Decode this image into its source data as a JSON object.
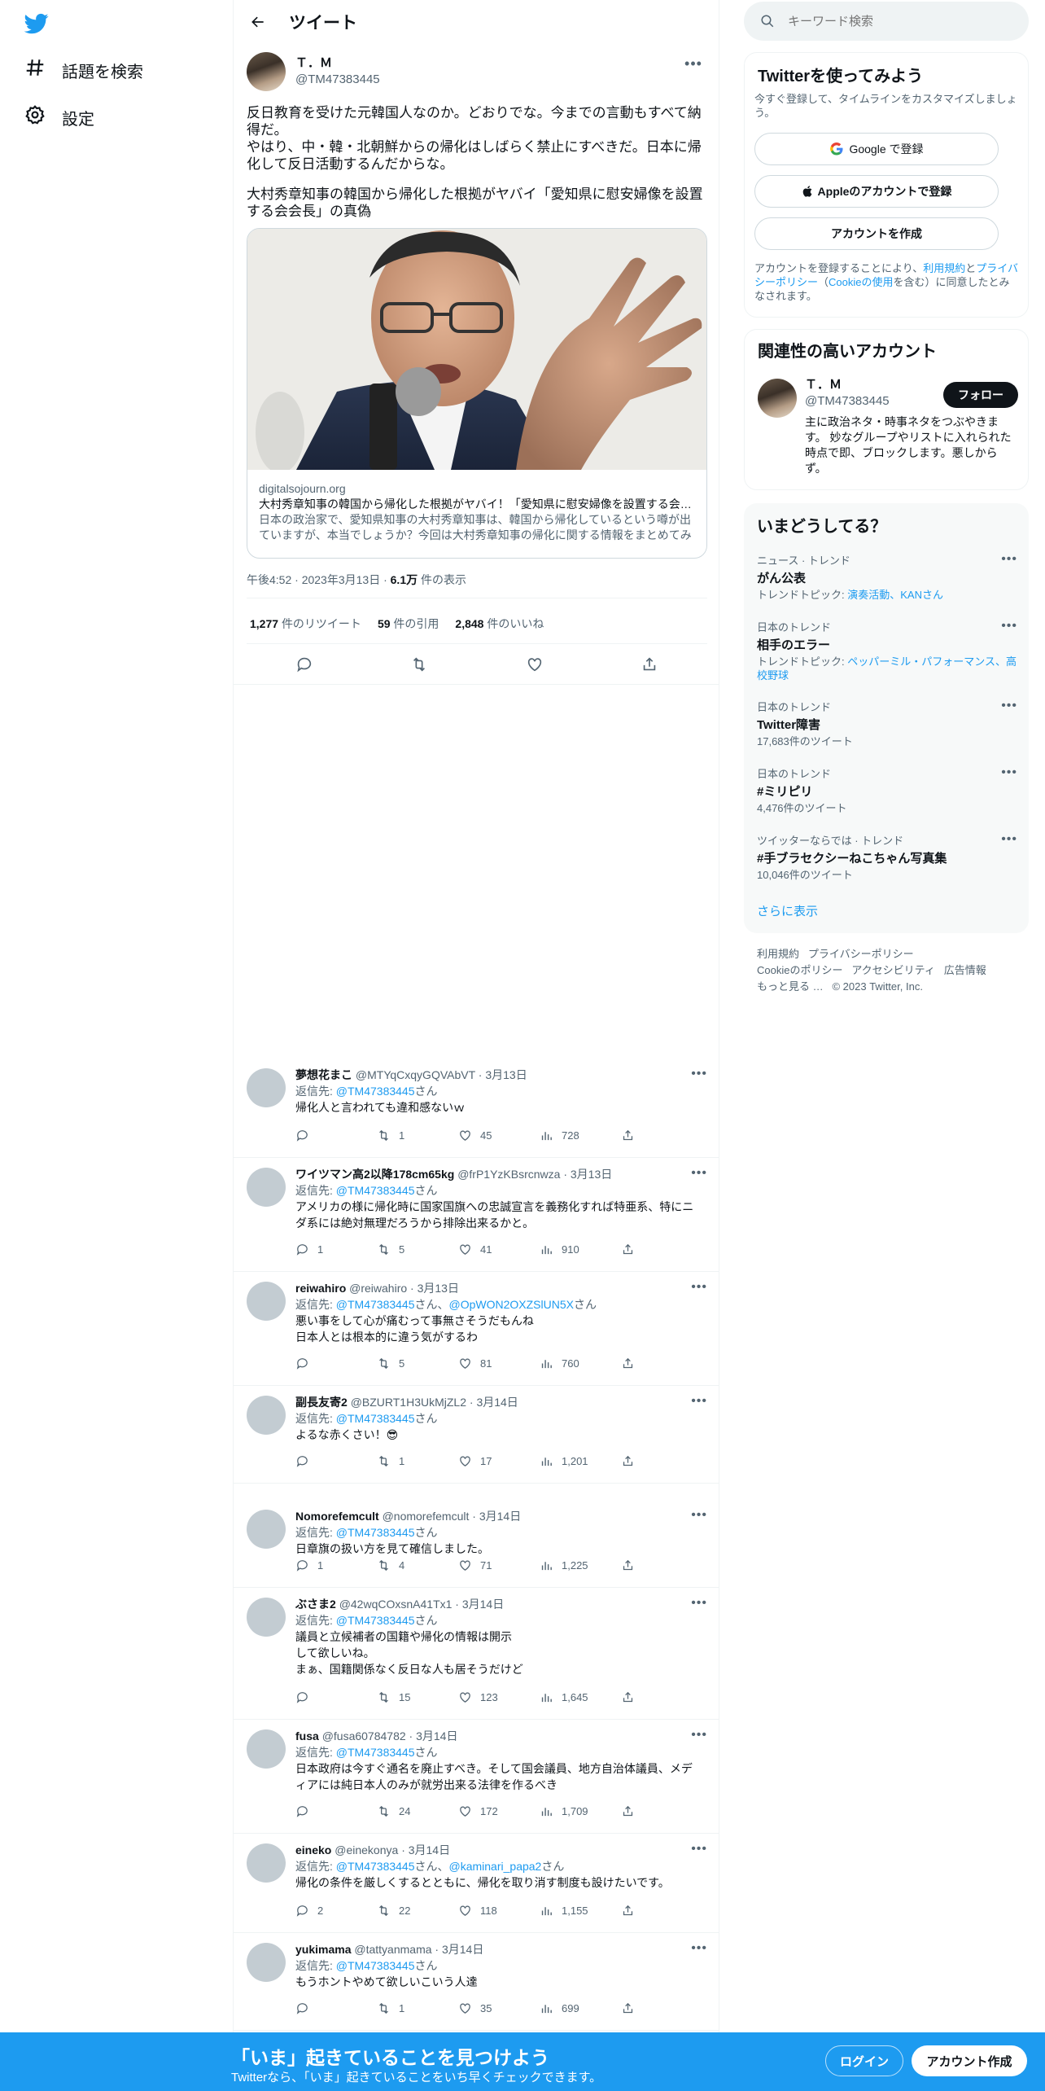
{
  "nav": {
    "explore": "話題を検索",
    "settings": "設定"
  },
  "header": {
    "title": "ツイート"
  },
  "tweet": {
    "author_name": "Ｔ．Ｍ",
    "author_handle": "@TM47383445",
    "text": "反日教育を受けた元韓国人なのか。どおりでな。今までの言動もすべて納得だ。\nやはり、中・韓・北朝鮮からの帰化はしばらく禁止にすべきだ。日本に帰化して反日活動するんだからな。",
    "text2": "大村秀章知事の韓国から帰化した根拠がヤバイ「愛知県に慰安婦像を設置する会会長」の真偽",
    "card": {
      "domain": "digitalsojourn.org",
      "title": "大村秀章知事の韓国から帰化した根拠がヤバイ！「愛知県に慰安婦像を設置する会会長」の真偽",
      "description": "日本の政治家で、愛知県知事の大村秀章知事は、韓国から帰化しているという噂が出ていますが、本当でしょうか？今回は大村秀章知事の帰化に関する情報をまとめてみました。"
    },
    "time": "午後4:52 · 2023年3月13日 · ",
    "views": "6.1万",
    "views_label": " 件の表示",
    "retweets": "1,277",
    "retweets_label": "件のリツイート",
    "quotes": "59",
    "quotes_label": "件の引用",
    "likes": "2,848",
    "likes_label": "件のいいね"
  },
  "replies": [
    {
      "name": "夢想花まこ",
      "handle": "@MTYqCxqyGQVAbVT",
      "date": "· 3月13日",
      "to_label": "返信先: ",
      "to": "@TM47383445",
      "to_suffix": "さん",
      "text": "帰化人と言われても違和感ないｗ",
      "replies": "",
      "retweets": "1",
      "likes": "45",
      "views": "728"
    },
    {
      "name": "ワイツマン高2以降178cm65kg",
      "handle": "@frP1YzKBsrcnwza",
      "date": "· 3月13日",
      "to_label": "返信先: ",
      "to": "@TM47383445",
      "to_suffix": "さん",
      "text": "アメリカの様に帰化時に国家国旗への忠誠宣言を義務化すれば特亜系、特にニダ系には絶対無理だろうから排除出来るかと。",
      "replies": "1",
      "retweets": "5",
      "likes": "41",
      "views": "910"
    },
    {
      "name": "reiwahiro",
      "handle": "@reiwahiro",
      "date": "· 3月13日",
      "to_label": "返信先: ",
      "to": "@TM47383445",
      "to_suffix": "さん、",
      "to2": "@OpWON2OXZSlUN5X",
      "to2_suffix": "さん",
      "text": "悪い事をして心が痛むって事無さそうだもんね\n日本人とは根本的に違う気がするわ",
      "replies": "",
      "retweets": "5",
      "likes": "81",
      "views": "760"
    },
    {
      "name": "副長友寄2",
      "handle": "@BZURT1H3UkMjZL2",
      "date": "· 3月14日",
      "to_label": "返信先: ",
      "to": "@TM47383445",
      "to_suffix": "さん",
      "text": "よるな赤くさい！😎",
      "replies": "",
      "retweets": "1",
      "likes": "17",
      "views": "1,201"
    },
    {
      "name": "Nomorefemcult",
      "handle": "@nomorefemcult",
      "date": "· 3月14日",
      "to_label": "返信先: ",
      "to": "@TM47383445",
      "to_suffix": "さん",
      "text": "日章旗の扱い方を見て確信しました。",
      "replies": "1",
      "retweets": "4",
      "likes": "71",
      "views": "1,225"
    },
    {
      "name": "ぶさま2",
      "handle": "@42wqCOxsnA41Tx1",
      "date": "· 3月14日",
      "to_label": "返信先: ",
      "to": "@TM47383445",
      "to_suffix": "さん",
      "text": "議員と立候補者の国籍や帰化の情報は開示\nして欲しいね。\nまぁ、国籍関係なく反日な人も居そうだけど",
      "replies": "",
      "retweets": "15",
      "likes": "123",
      "views": "1,645"
    },
    {
      "name": "fusa",
      "handle": "@fusa60784782",
      "date": "· 3月14日",
      "to_label": "返信先: ",
      "to": "@TM47383445",
      "to_suffix": "さん",
      "text": "日本政府は今すぐ通名を廃止すべき。そして国会議員、地方自治体議員、メディアには純日本人のみが就労出来る法律を作るべき",
      "replies": "",
      "retweets": "24",
      "likes": "172",
      "views": "1,709"
    },
    {
      "name": "eineko",
      "handle": "@einekonya",
      "date": "· 3月14日",
      "to_label": "返信先: ",
      "to": "@TM47383445",
      "to_suffix": "さん、",
      "to2": "@kaminari_papa2",
      "to2_suffix": "さん",
      "text": "帰化の条件を厳しくするとともに、帰化を取り消す制度も設けたいです。",
      "replies": "2",
      "retweets": "22",
      "likes": "118",
      "views": "1,155"
    },
    {
      "name": "yukimama",
      "handle": "@tattyanmama",
      "date": "· 3月14日",
      "to_label": "返信先: ",
      "to": "@TM47383445",
      "to_suffix": "さん",
      "text": "もうホントやめて欲しいこいう人達",
      "replies": "",
      "retweets": "1",
      "likes": "35",
      "views": "699"
    }
  ],
  "right": {
    "search_placeholder": "キーワード検索",
    "signup_box": {
      "title": "Twitterを使ってみよう",
      "subtitle": "今すぐ登録して、タイムラインをカスタマイズしましょう。",
      "google": "Google で登録",
      "apple": "Appleのアカウントで登録",
      "create": "アカウントを作成",
      "terms_pre": "アカウントを登録することにより、",
      "terms_link": "利用規約",
      "terms_and": "と",
      "privacy_link": "プライバシーポリシー",
      "cookie_pre": "（",
      "cookie_link": "Cookieの使用",
      "terms_post": "を含む）に同意したとみなされます。"
    },
    "related": {
      "title": "関連性の高いアカウント",
      "name": "Ｔ．Ｍ",
      "handle": "@TM47383445",
      "follow": "フォロー",
      "bio": "主に政治ネタ・時事ネタをつぶやきます。 妙なグループやリストに入れられた時点で即、ブロックします。悪しからず。"
    },
    "trends": {
      "title": "いまどうしてる？",
      "items": [
        {
          "context": "ニュース · トレンド",
          "name": "がん公表",
          "sub_label": "トレンドトピック: ",
          "sub_links": "演奏活動、KANさん"
        },
        {
          "context": "日本のトレンド",
          "name": "相手のエラー",
          "sub_label": "トレンドトピック: ",
          "sub_links": "ペッパーミル・パフォーマンス、高校野球"
        },
        {
          "context": "日本のトレンド",
          "name": "Twitter障害",
          "sub": "17,683件のツイート"
        },
        {
          "context": "日本のトレンド",
          "name": "#ミリピリ",
          "sub": "4,476件のツイート"
        },
        {
          "context": "ツイッターならでは · トレンド",
          "name": "#手ブラセクシーねこちゃん写真集",
          "sub": "10,046件のツイート"
        }
      ],
      "show_more": "さらに表示"
    },
    "footer": {
      "terms": "利用規約",
      "privacy": "プライバシーポリシー",
      "cookie": "Cookieのポリシー",
      "accessibility": "アクセシビリティ",
      "ads": "広告情報",
      "more": "もっと見る …",
      "copyright": "© 2023 Twitter, Inc."
    }
  },
  "bottom_bar": {
    "title": "「いま」起きていることを見つけよう",
    "subtitle": "Twitterなら、「いま」起きていることをいち早くチェックできます。",
    "login": "ログイン",
    "signup": "アカウント作成"
  },
  "colors": {
    "accent": "#1d9bf0",
    "text": "#0f1419",
    "muted": "#536471"
  }
}
